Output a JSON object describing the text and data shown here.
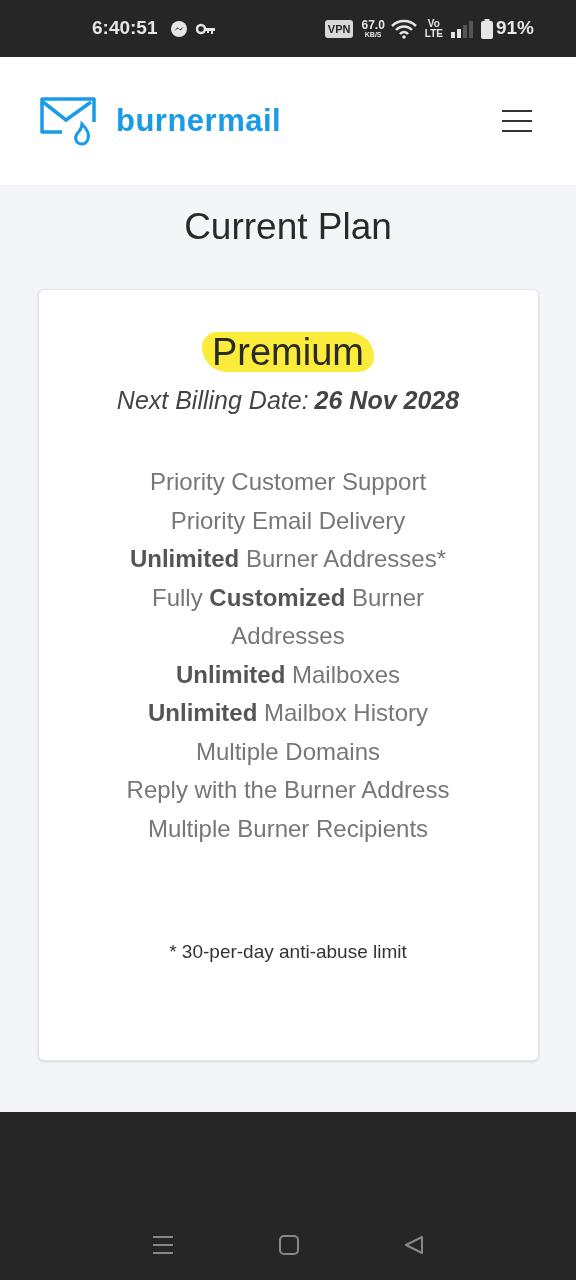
{
  "status_bar": {
    "time": "6:40:51",
    "vpn": "VPN",
    "speed": "67.0",
    "speed_unit": "KB/S",
    "volte_top": "Vo",
    "volte_bottom": "LTE",
    "battery": "91%"
  },
  "header": {
    "brand": "burnermail"
  },
  "page": {
    "title": "Current Plan"
  },
  "plan": {
    "name": "Premium",
    "billing_label": "Next Billing Date:",
    "billing_date": "26 Nov 2028",
    "features": [
      "Priority Customer Support",
      "Priority Email Delivery",
      "**Unlimited** Burner Addresses*",
      "Fully **Customized** Burner Addresses",
      "**Unlimited** Mailboxes",
      "**Unlimited** Mailbox History",
      "Multiple Domains",
      "Reply with the Burner Address",
      "Multiple Burner Recipients"
    ],
    "footnote": "* 30-per-day anti-abuse limit"
  }
}
